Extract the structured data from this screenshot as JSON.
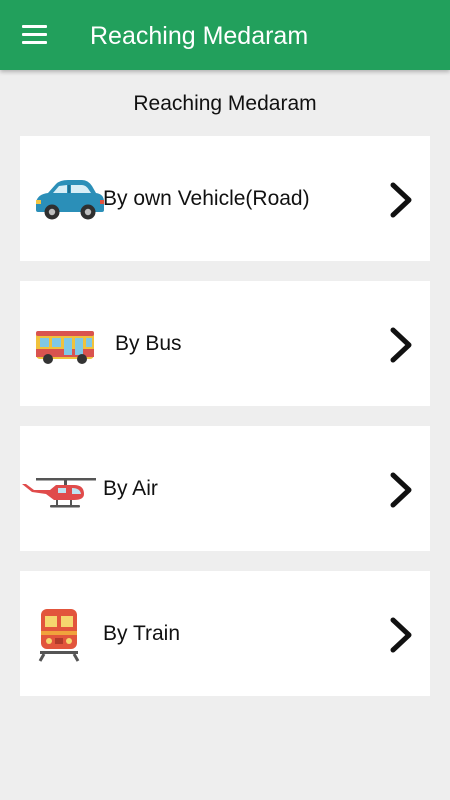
{
  "app_bar": {
    "title": "Reaching Medaram",
    "menu_icon": "hamburger-menu-icon",
    "color": "#22A05C"
  },
  "page": {
    "heading": "Reaching Medaram",
    "background": "#EEEEEE"
  },
  "options": [
    {
      "label": "By own Vehicle(Road)",
      "icon": "car-icon"
    },
    {
      "label": "By Bus",
      "icon": "bus-icon"
    },
    {
      "label": "By Air",
      "icon": "helicopter-icon"
    },
    {
      "label": "By Train",
      "icon": "train-icon"
    }
  ],
  "chevron_icon": "chevron-right-icon"
}
